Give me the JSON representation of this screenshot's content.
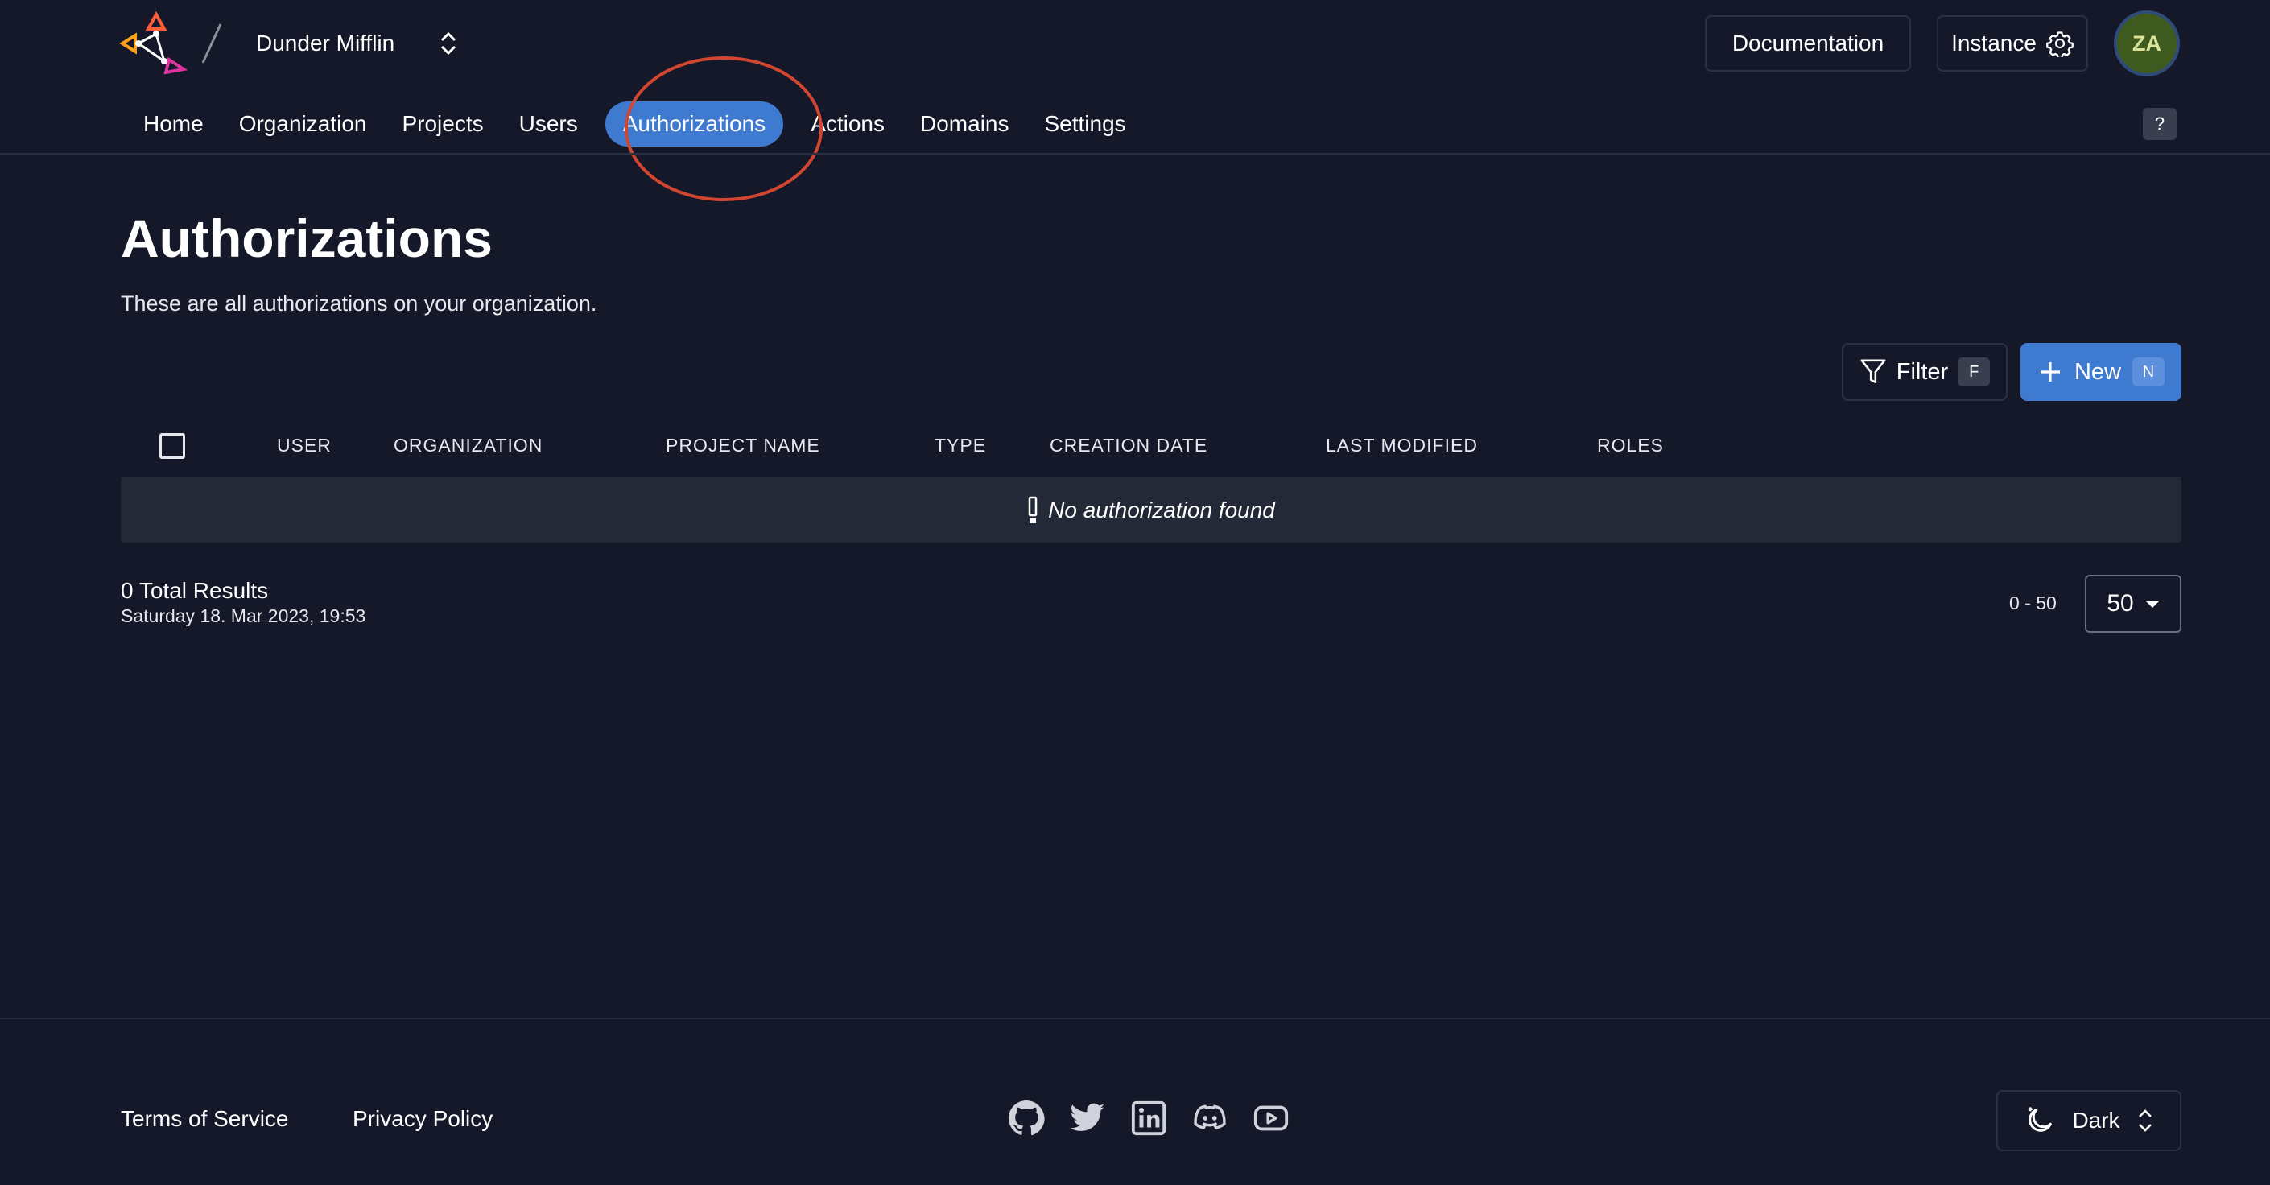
{
  "header": {
    "org_name": "Dunder Mifflin",
    "documentation_label": "Documentation",
    "instance_label": "Instance",
    "avatar_initials": "ZA",
    "help_label": "?"
  },
  "nav": {
    "items": [
      {
        "label": "Home"
      },
      {
        "label": "Organization"
      },
      {
        "label": "Projects"
      },
      {
        "label": "Users"
      },
      {
        "label": "Authorizations"
      },
      {
        "label": "Actions"
      },
      {
        "label": "Domains"
      },
      {
        "label": "Settings"
      }
    ],
    "active": "Authorizations"
  },
  "main": {
    "title": "Authorizations",
    "description": "These are all authorizations on your organization.",
    "filter_label": "Filter",
    "filter_shortcut": "F",
    "new_label": "New",
    "new_shortcut": "N",
    "columns": [
      "USER",
      "ORGANIZATION",
      "PROJECT NAME",
      "TYPE",
      "CREATION DATE",
      "LAST MODIFIED",
      "ROLES"
    ],
    "empty_message": "No authorization found",
    "total_results": "0 Total Results",
    "timestamp": "Saturday 18. Mar 2023, 19:53",
    "range": "0 - 50",
    "page_size": "50"
  },
  "footer": {
    "terms_label": "Terms of Service",
    "privacy_label": "Privacy Policy",
    "social_icons": [
      "github-icon",
      "twitter-icon",
      "linkedin-icon",
      "discord-icon",
      "youtube-icon"
    ],
    "theme_label": "Dark"
  },
  "colors": {
    "background": "#141828",
    "accent": "#3f7ad1",
    "annotation_ring": "#d24530",
    "empty_row": "#242937"
  }
}
